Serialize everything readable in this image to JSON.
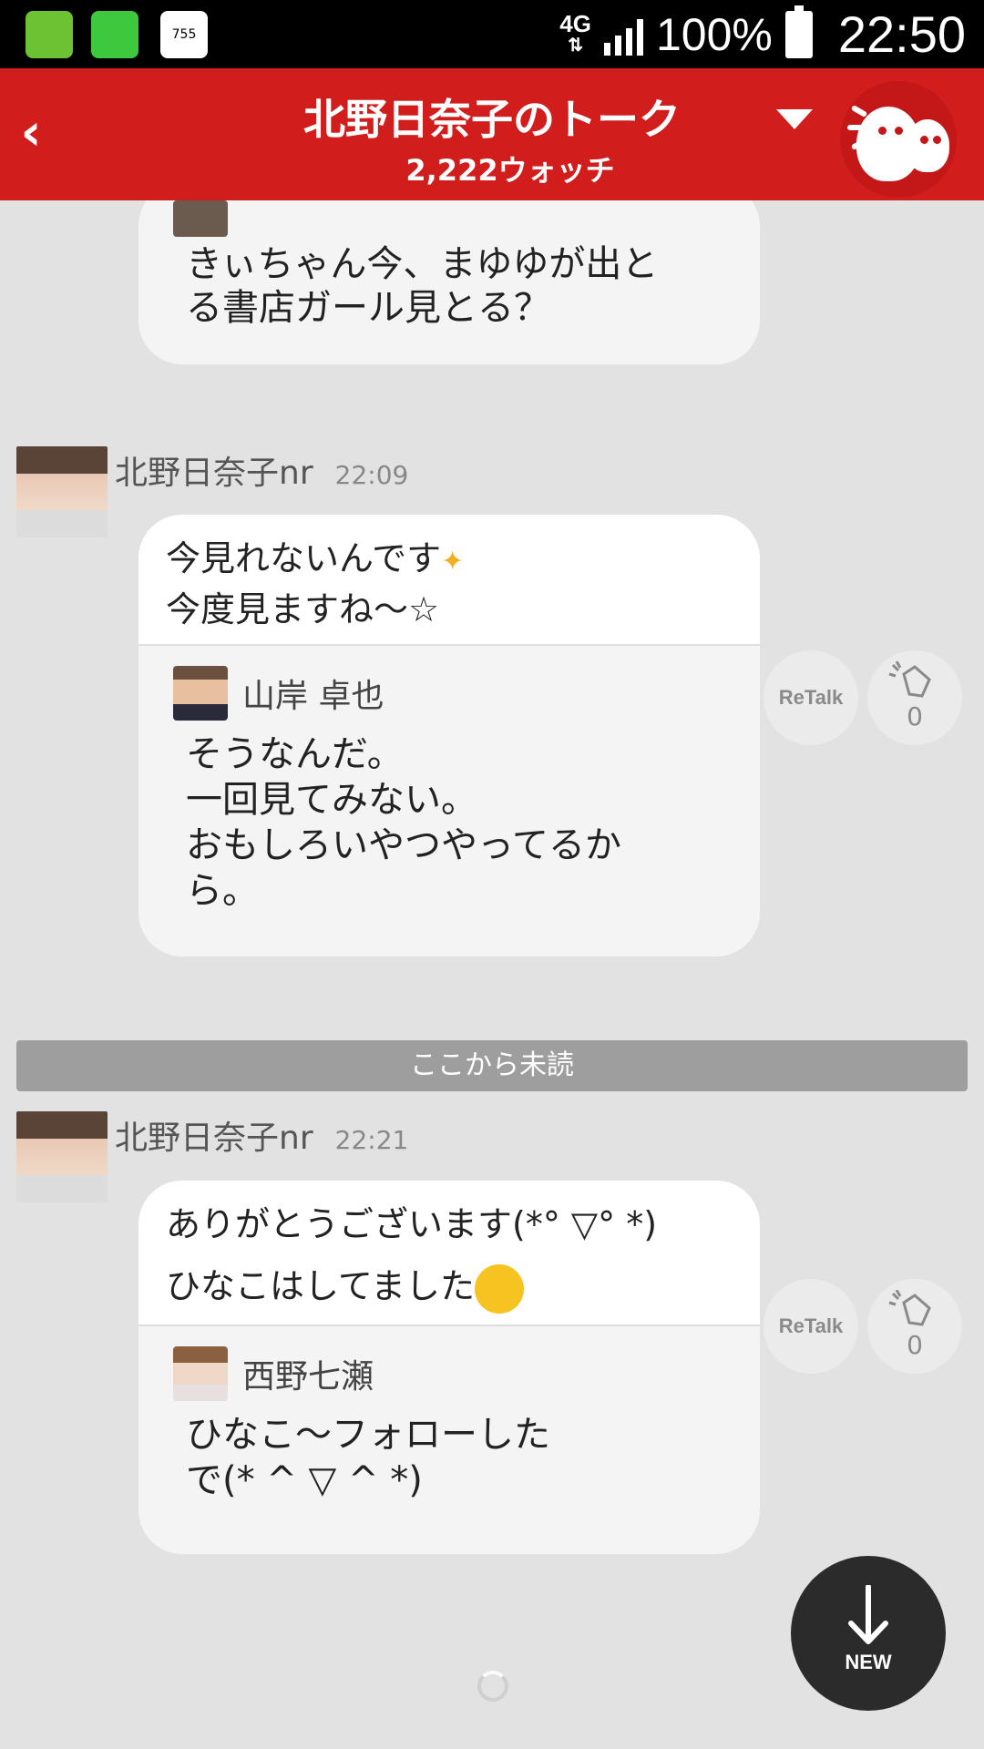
{
  "status_bar": {
    "apps": [
      "app-icon",
      "LINE",
      "755"
    ],
    "network": "4G",
    "battery": "100%",
    "time": "22:50"
  },
  "header": {
    "back_label": "‹",
    "title": "北野日奈子のトーク",
    "watch_count": "2,222ウォッチ"
  },
  "messages": [
    {
      "type": "partial_quote",
      "quoted_text": "きぃちゃん今、まゆゆが出と\nる書店ガール見とる？"
    },
    {
      "author": "北野日奈子nr",
      "time": "22:09",
      "text_lines": [
        "今見れないんです",
        "今度見ますね～☆"
      ],
      "emoji": "sparkles",
      "quoted": {
        "name": "山岸 卓也",
        "text": "そうなんだ。\n一回見てみない。\nおもしろいやつやってるか\nら。"
      },
      "retalk_label": "ReTalk",
      "clap_count": "0"
    },
    {
      "author": "北野日奈子nr",
      "time": "22:21",
      "text_lines": [
        "ありがとうございます(*° ▽° *)",
        "ひなこはしてました"
      ],
      "emoji": "grin",
      "quoted": {
        "name": "西野七瀬",
        "text": "ひなこ～フォローした\nで(* ^ ▽ ^ *)"
      },
      "retalk_label": "ReTalk",
      "clap_count": "0"
    }
  ],
  "unread_divider": "ここから未読",
  "new_button": "NEW"
}
